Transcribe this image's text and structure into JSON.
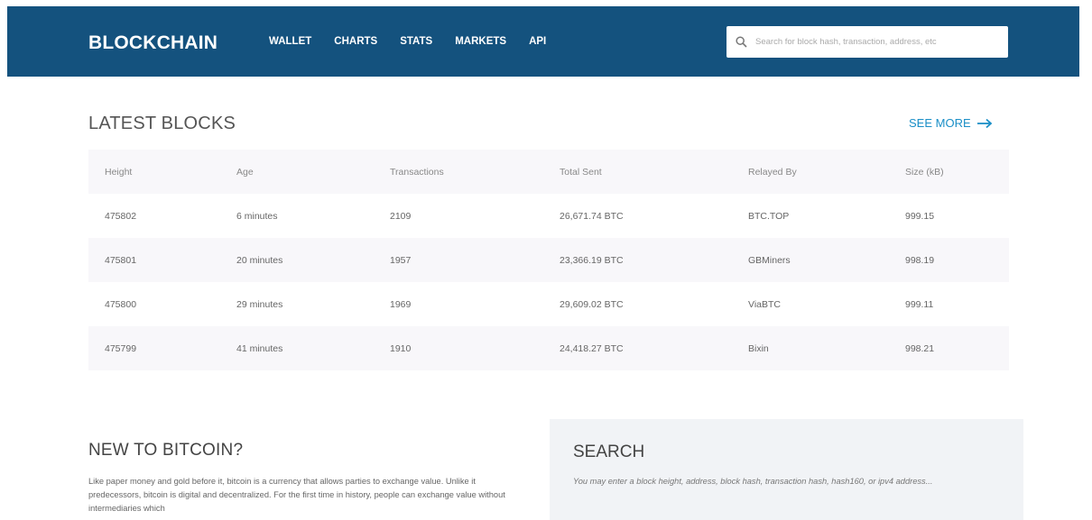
{
  "header": {
    "logo": "BLOCKCHAIN",
    "nav": [
      "WALLET",
      "CHARTS",
      "STATS",
      "MARKETS",
      "API"
    ],
    "search_placeholder": "Search for block hash, transaction, address, etc"
  },
  "latest_blocks": {
    "title": "LATEST BLOCKS",
    "see_more": "SEE MORE",
    "columns": [
      "Height",
      "Age",
      "Transactions",
      "Total Sent",
      "Relayed By",
      "Size (kB)"
    ],
    "rows": [
      {
        "height": "475802",
        "age": "6 minutes",
        "transactions": "2109",
        "total_sent": "26,671.74 BTC",
        "relayed_by": "BTC.TOP",
        "size": "999.15"
      },
      {
        "height": "475801",
        "age": "20 minutes",
        "transactions": "1957",
        "total_sent": "23,366.19 BTC",
        "relayed_by": "GBMiners",
        "size": "998.19"
      },
      {
        "height": "475800",
        "age": "29 minutes",
        "transactions": "1969",
        "total_sent": "29,609.02 BTC",
        "relayed_by": "ViaBTC",
        "size": "999.11"
      },
      {
        "height": "475799",
        "age": "41 minutes",
        "transactions": "1910",
        "total_sent": "24,418.27 BTC",
        "relayed_by": "Bixin",
        "size": "998.21"
      }
    ]
  },
  "new_to_bitcoin": {
    "title": "NEW TO BITCOIN?",
    "text": "Like paper money and gold before it, bitcoin is a currency that allows parties to exchange value. Unlike it predecessors, bitcoin is digital and decentralized. For the first time in history, people can exchange value without intermediaries which"
  },
  "search_panel": {
    "title": "SEARCH",
    "text": "You may enter a block height, address, block hash, transaction hash, hash160, or ipv4 address..."
  },
  "colors": {
    "header_bg": "#14527e",
    "link": "#1b8fc7"
  },
  "icons": {
    "search": "search-icon",
    "see_more": "arrow-right-icon"
  }
}
